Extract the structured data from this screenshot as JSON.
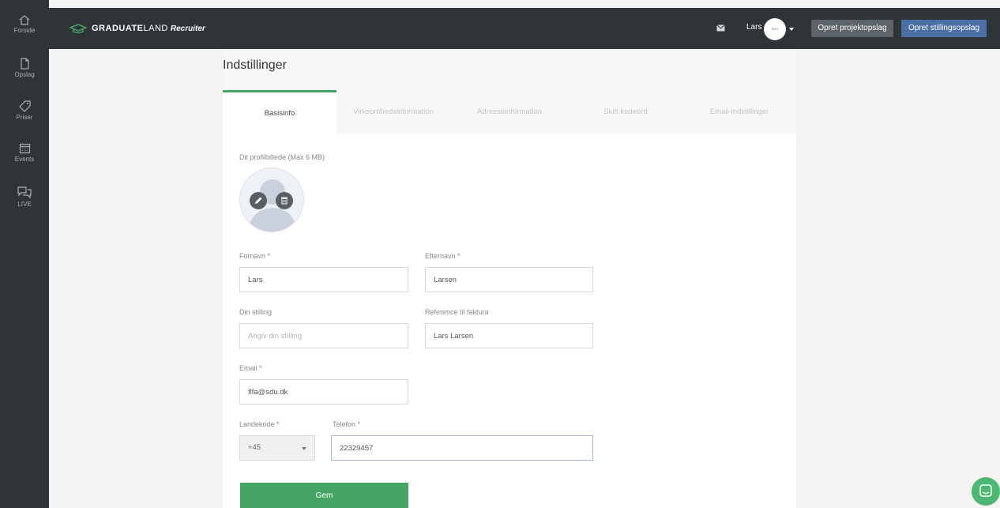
{
  "sidebar": {
    "items": [
      {
        "label": "Forside",
        "icon": "home-icon"
      },
      {
        "label": "Opslag",
        "icon": "document-icon"
      },
      {
        "label": "Priser",
        "icon": "tag-icon"
      },
      {
        "label": "Events",
        "icon": "calendar-icon"
      },
      {
        "label": "LIVE",
        "icon": "chat-icon"
      }
    ]
  },
  "header": {
    "logo_brand": "GRADUATE",
    "logo_brand_light": "LAND",
    "logo_product": "Recruiter",
    "user_name": "Lars",
    "avatar_label": "SDU",
    "create_project_label": "Opret projektopslag",
    "create_job_label": "Opret stillingsopslag"
  },
  "page": {
    "title": "Indstillinger"
  },
  "tabs": [
    {
      "label": "Basisinfo",
      "active": true
    },
    {
      "label": "Virksomhedsinformation",
      "active": false
    },
    {
      "label": "Adresseinformation",
      "active": false
    },
    {
      "label": "Skift kodeord",
      "active": false
    },
    {
      "label": "Email-indstillinger",
      "active": false
    }
  ],
  "form": {
    "profile_picture_label": "Dit profilbillede (Max 6 MB)",
    "first_name_label": "Fornavn *",
    "first_name_value": "Lars",
    "last_name_label": "Efternavn *",
    "last_name_value": "Larsen",
    "position_label": "Din stilling",
    "position_placeholder": "Angiv din stilling",
    "invoice_ref_label": "Reference til faktura",
    "invoice_ref_value": "Lars Larsen",
    "email_label": "Email *",
    "email_value": "flfa@sdu.dk",
    "country_code_label": "Landekode *",
    "country_code_value": "+45",
    "phone_label": "Telefon *",
    "phone_value": "22329457",
    "save_label": "Gem"
  },
  "colors": {
    "accent_green": "#43a463",
    "primary_blue": "#4a6fa5",
    "dark_bar": "#2f3437"
  }
}
